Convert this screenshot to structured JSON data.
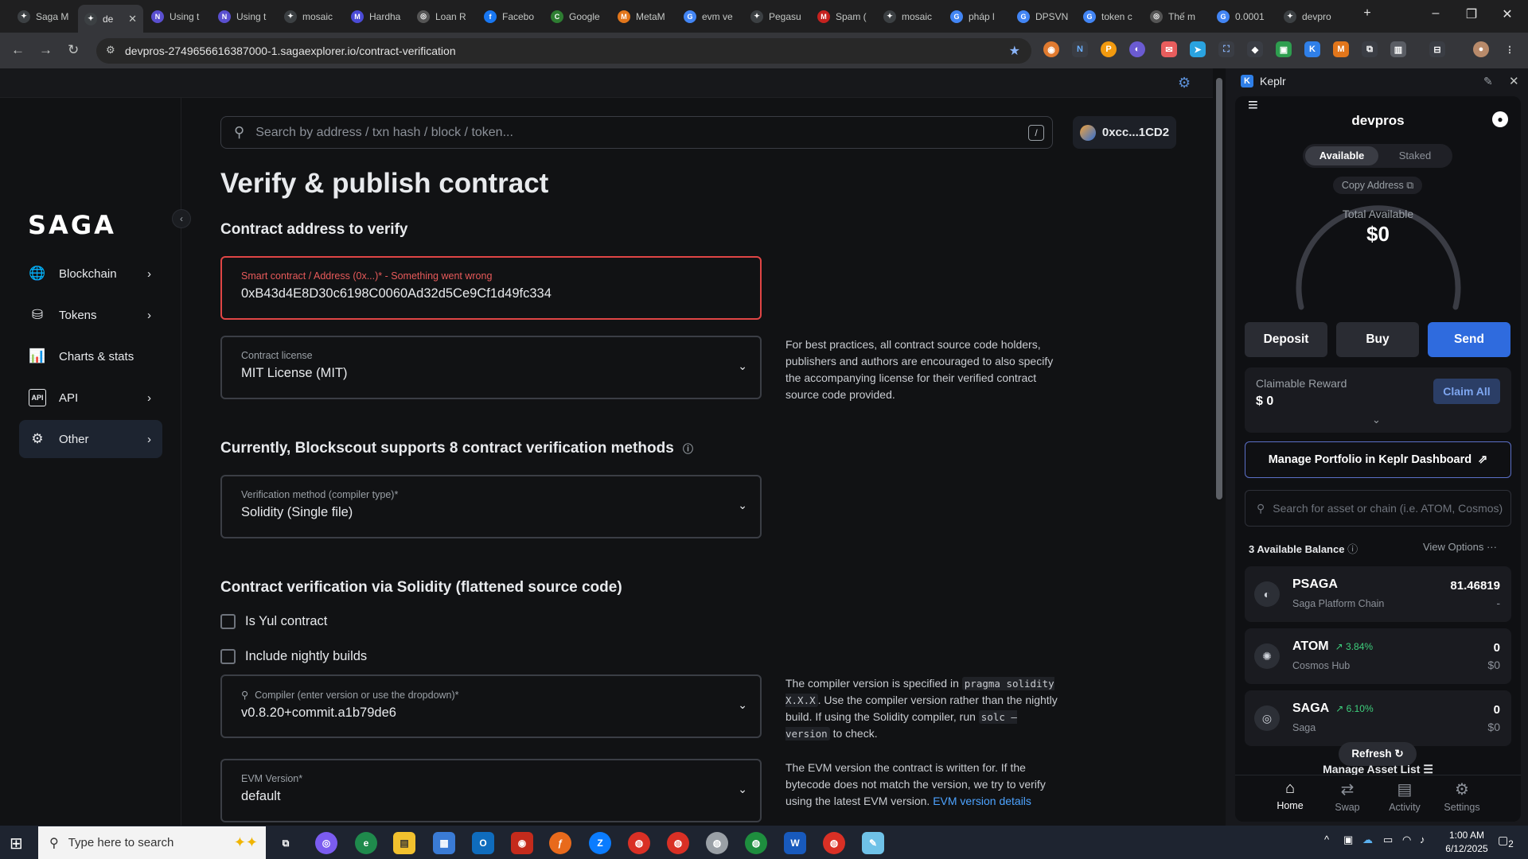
{
  "browser": {
    "tabs": [
      {
        "label": "Saga M",
        "color": "#3c4043",
        "glyph": "✦"
      },
      {
        "label": "de",
        "color": "#3c4043",
        "glyph": "✦",
        "active": true
      },
      {
        "label": "Using t",
        "color": "#5a4fcf",
        "glyph": "N"
      },
      {
        "label": "Using t",
        "color": "#5a4fcf",
        "glyph": "N"
      },
      {
        "label": "mosaic",
        "color": "#3c4043",
        "glyph": "✦"
      },
      {
        "label": "Hardha",
        "color": "#4b4bd6",
        "glyph": "M"
      },
      {
        "label": "Loan R",
        "color": "#555",
        "glyph": "◎"
      },
      {
        "label": "Facebo",
        "color": "#1877f2",
        "glyph": "f"
      },
      {
        "label": "Google",
        "color": "#2e7d32",
        "glyph": "C"
      },
      {
        "label": "MetaM",
        "color": "#e2761b",
        "glyph": "M"
      },
      {
        "label": "evm ve",
        "color": "#4285f4",
        "glyph": "G"
      },
      {
        "label": "Pegasu",
        "color": "#3c4043",
        "glyph": "✦"
      },
      {
        "label": "Spam (",
        "color": "#c5221f",
        "glyph": "M"
      },
      {
        "label": "mosaic",
        "color": "#3c4043",
        "glyph": "✦"
      },
      {
        "label": "pháp l",
        "color": "#4285f4",
        "glyph": "G"
      },
      {
        "label": "DPSVN",
        "color": "#4285f4",
        "glyph": "G"
      },
      {
        "label": "token c",
        "color": "#4285f4",
        "glyph": "G"
      },
      {
        "label": "Thế m",
        "color": "#555",
        "glyph": "◎"
      },
      {
        "label": "0.0001",
        "color": "#4285f4",
        "glyph": "G"
      },
      {
        "label": "devpro",
        "color": "#3c4043",
        "glyph": "✦"
      }
    ],
    "url": "devpros-2749656616387000-1.sagaexplorer.io/contract-verification"
  },
  "sidebar": {
    "logo": "SAGA",
    "items": [
      {
        "label": "Blockchain",
        "icon": "globe-icon",
        "glyph": "🌐"
      },
      {
        "label": "Tokens",
        "icon": "tokens-icon",
        "glyph": "⛁"
      },
      {
        "label": "Charts & stats",
        "icon": "chart-icon",
        "glyph": "📊"
      },
      {
        "label": "API",
        "icon": "api-icon",
        "glyph": "API"
      },
      {
        "label": "Other",
        "icon": "gear-icon",
        "glyph": "⚙"
      }
    ]
  },
  "header": {
    "search_placeholder": "Search by address / txn hash / block / token...",
    "slash": "/",
    "wallet": "0xcc...1CD2"
  },
  "main": {
    "title": "Verify & publish contract",
    "address_section": "Contract address to verify",
    "address_label": "Smart contract / Address (0x...)* - Something went wrong",
    "address_value": "0xB43d4E8D30c6198C0060Ad32d5Ce9Cf1d49fc334",
    "license_label": "Contract license",
    "license_value": "MIT License (MIT)",
    "license_hint": "For best practices, all contract source code holders, publishers and authors are encouraged to also specify the accompanying license for their verified contract source code provided.",
    "methods_heading": "Currently, Blockscout supports 8 contract verification methods",
    "method_label": "Verification method (compiler type)*",
    "method_value": "Solidity (Single file)",
    "solidity_heading": "Contract verification via Solidity (flattened source code)",
    "yul_label": "Is Yul contract",
    "nightly_label": "Include nightly builds",
    "compiler_label": "Compiler (enter version or use the dropdown)*",
    "compiler_value": "v0.8.20+commit.a1b79de6",
    "compiler_hint_1": "The compiler version is specified in",
    "compiler_hint_code1": "pragma solidity X.X.X",
    "compiler_hint_2": ". Use the compiler version rather than the nightly build. If using the Solidity compiler, run",
    "compiler_hint_code2": "solc —version",
    "compiler_hint_3": "to check.",
    "evm_label": "EVM Version*",
    "evm_value": "default",
    "evm_hint": "The EVM version the contract is written for. If the bytecode does not match the version, we try to verify using the latest EVM version.",
    "evm_hint_link": "EVM version details"
  },
  "keplr": {
    "title": "Keplr",
    "account": "devpros",
    "tab_available": "Available",
    "tab_staked": "Staked",
    "copy_address": "Copy Address",
    "total_label": "Total Available",
    "total_value": "$0",
    "deposit": "Deposit",
    "buy": "Buy",
    "send": "Send",
    "claimable_label": "Claimable Reward",
    "claimable_value": "$ 0",
    "claim_all": "Claim All",
    "manage_portfolio": "Manage Portfolio in Keplr Dashboard",
    "search_placeholder": "Search for asset or chain (i.e. ATOM, Cosmos)",
    "balance_count": "3",
    "balance_label": "Available Balance",
    "view_options": "View Options",
    "assets": [
      {
        "name": "PSAGA",
        "chain": "Saga Platform Chain",
        "change": "",
        "amount": "81.46819",
        "usd": "-"
      },
      {
        "name": "ATOM",
        "chain": "Cosmos Hub",
        "change": "3.84%",
        "amount": "0",
        "usd": "$0"
      },
      {
        "name": "SAGA",
        "chain": "Saga",
        "change": "6.10%",
        "amount": "0",
        "usd": "$0"
      }
    ],
    "refresh": "Refresh",
    "manage_assets": "Manage Asset List",
    "nav": [
      "Home",
      "Swap",
      "Activity",
      "Settings"
    ]
  },
  "taskbar": {
    "search_placeholder": "Type here to search",
    "time": "1:00 AM",
    "date": "6/12/2025",
    "notif_count": "2"
  }
}
